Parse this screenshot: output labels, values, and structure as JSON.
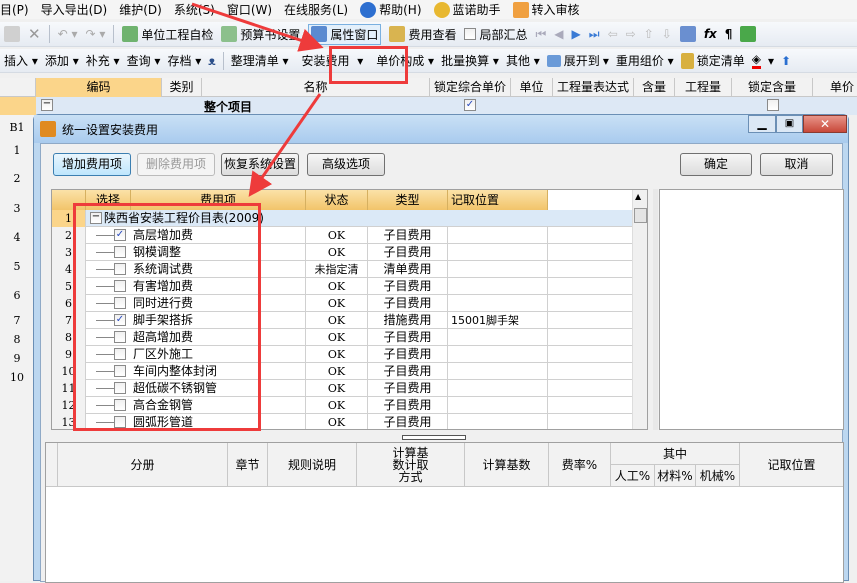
{
  "menu": [
    "目(P)",
    "导入导出(D)",
    "维护(D)",
    "系统(S)",
    "窗口(W)",
    "在线服务(L)",
    "帮助(H)",
    "蓝诺助手",
    "转入审核"
  ],
  "toolbar1": {
    "items": [
      "单位工程自检",
      "预算书设置",
      "属性窗口",
      "费用查看",
      "局部汇总"
    ]
  },
  "toolbar2": {
    "items": [
      "插入",
      "添加",
      "补充",
      "查询",
      "存档",
      "整理清单",
      "安装费用",
      "单价构成",
      "批量换算",
      "其他",
      "展开到",
      "重用组价",
      "锁定清单"
    ]
  },
  "main_grid": {
    "headers": [
      "编码",
      "类别",
      "名称",
      "锁定综合单价",
      "单位",
      "工程量表达式",
      "含量",
      "工程量",
      "锁定含量",
      "单价"
    ],
    "top_row": {
      "name": "整个项目",
      "lock_price": true,
      "lock_content": false
    },
    "row_labels": [
      "B1",
      "1",
      "2",
      "3",
      "4",
      "5",
      "6",
      "7",
      "8",
      "9",
      "10"
    ]
  },
  "dialog": {
    "title": "统一设置安装费用",
    "buttons": {
      "add": "增加费用项",
      "delete": "删除费用项",
      "restore": "恢复系统设置",
      "advanced": "高级选项",
      "ok": "确定",
      "cancel": "取消"
    },
    "fee_grid": {
      "headers": [
        "选择",
        "费用项",
        "状态",
        "类型",
        "记取位置"
      ],
      "group": {
        "num": "1",
        "label": "陕西省安装工程价目表(2009)"
      },
      "rows": [
        {
          "num": "2",
          "checked": true,
          "name": "高层增加费",
          "status": "OK",
          "type": "子目费用",
          "position": ""
        },
        {
          "num": "3",
          "checked": false,
          "name": "钢模调整",
          "status": "OK",
          "type": "子目费用",
          "position": ""
        },
        {
          "num": "4",
          "checked": false,
          "name": "系统调试费",
          "status": "未指定清",
          "type": "清单费用",
          "position": ""
        },
        {
          "num": "5",
          "checked": false,
          "name": "有害增加费",
          "status": "OK",
          "type": "子目费用",
          "position": ""
        },
        {
          "num": "6",
          "checked": false,
          "name": "同时进行费",
          "status": "OK",
          "type": "子目费用",
          "position": ""
        },
        {
          "num": "7",
          "checked": true,
          "name": "脚手架搭拆",
          "status": "OK",
          "type": "措施费用",
          "position": "15001脚手架"
        },
        {
          "num": "8",
          "checked": false,
          "name": "超高增加费",
          "status": "OK",
          "type": "子目费用",
          "position": ""
        },
        {
          "num": "9",
          "checked": false,
          "name": "厂区外施工",
          "status": "OK",
          "type": "子目费用",
          "position": ""
        },
        {
          "num": "10",
          "checked": false,
          "name": "车间内整体封闭",
          "status": "OK",
          "type": "子目费用",
          "position": ""
        },
        {
          "num": "11",
          "checked": false,
          "name": "超低碳不锈钢管",
          "status": "OK",
          "type": "子目费用",
          "position": ""
        },
        {
          "num": "12",
          "checked": false,
          "name": "高合金钢管",
          "status": "OK",
          "type": "子目费用",
          "position": ""
        },
        {
          "num": "13",
          "checked": false,
          "name": "圆弧形管道",
          "status": "OK",
          "type": "子目费用",
          "position": ""
        }
      ]
    },
    "rule_grid": {
      "headers": {
        "volume": "分册",
        "chapter": "章节",
        "rule": "规则说明",
        "calc_method": "计算基数计取方式",
        "calc_base": "计算基数",
        "rate": "费率%",
        "among": "其中",
        "labor": "人工%",
        "material": "材料%",
        "machine": "机械%",
        "position": "记取位置"
      }
    }
  },
  "colors": {
    "annotation": "#ee3b3b",
    "header_orange": "#f2c46a",
    "selection_blue": "#dbe9f7"
  }
}
